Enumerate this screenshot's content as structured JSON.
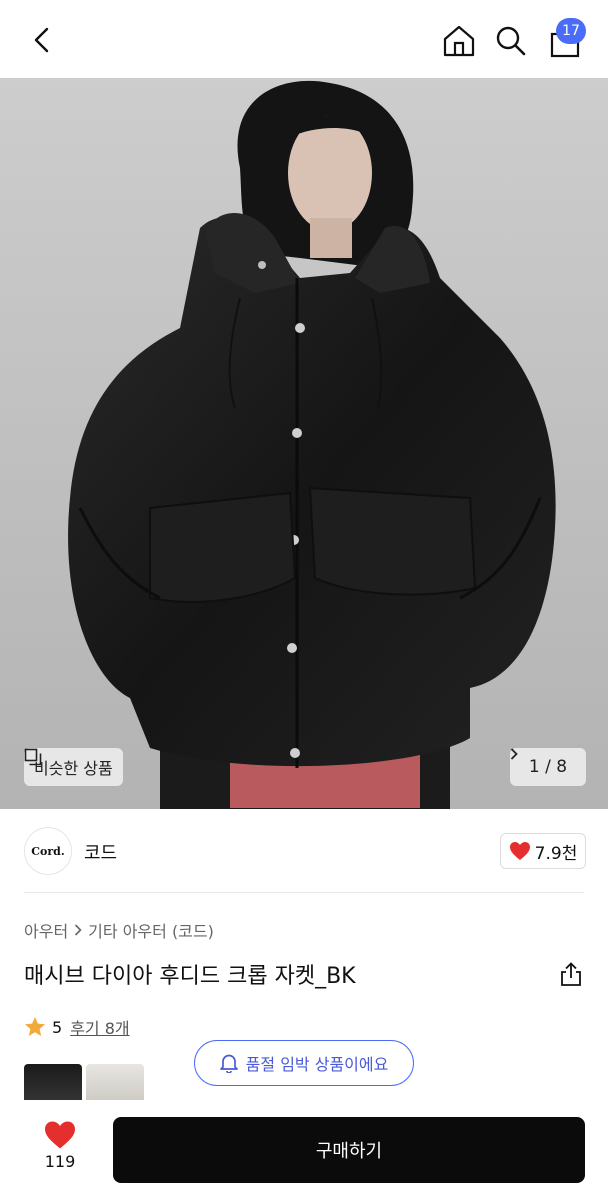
{
  "header": {
    "back_icon": "chevron-left-icon",
    "home_icon": "home-icon",
    "search_icon": "search-icon",
    "cart_icon": "shopping-bag-icon",
    "cart_count": "17",
    "accent_color": "#4a6cf7"
  },
  "gallery": {
    "similar_label": "비슷한 상품",
    "counter": "1 / 8"
  },
  "shop": {
    "logo_text": "Cord.",
    "name": "코드",
    "likes": "7.9천"
  },
  "product": {
    "breadcrumb": [
      "아우터",
      "기타 아우터 (코드)"
    ],
    "title": "매시브 다이아 후디드 크롭 자켓_BK",
    "rating": "5",
    "reviews_label": "후기 8개",
    "soldout_label": "품절 임박 상품이에요"
  },
  "bottom": {
    "wish_count": "119",
    "buy_label": "구매하기"
  }
}
